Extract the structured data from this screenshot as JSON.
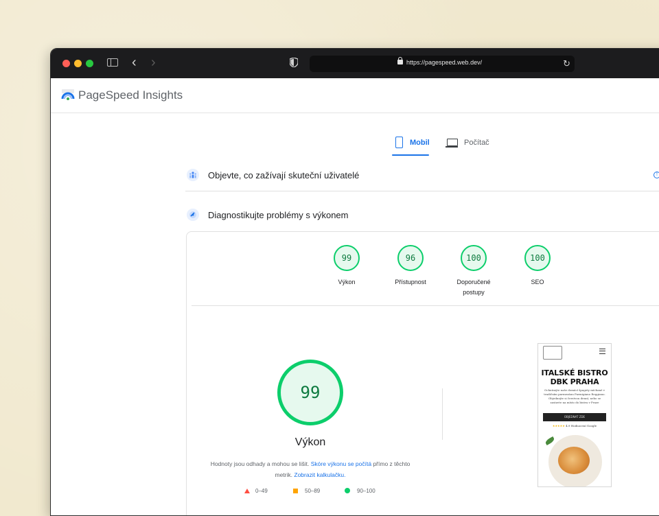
{
  "browser": {
    "url": "https://pagespeed.web.dev/"
  },
  "header": {
    "brand": "PageSpeed Insights"
  },
  "tabs": {
    "mobile": "Mobil",
    "desktop": "Počítač"
  },
  "sections": {
    "users": "Objevte, co zažívají skuteční uživatelé",
    "diagnose": "Diagnostikujte problémy s výkonem"
  },
  "scores": [
    {
      "value": "99",
      "label": "Výkon"
    },
    {
      "value": "96",
      "label": "Přístupnost"
    },
    {
      "value": "100",
      "label": "Doporučené postupy"
    },
    {
      "value": "100",
      "label": "SEO"
    }
  ],
  "performance": {
    "score": "99",
    "label": "Výkon",
    "desc_start": "Hodnoty jsou odhady a mohou se lišit.",
    "desc_link1": "Skóre výkonu se počítá",
    "desc_middle": "přímo z těchto metrik.",
    "desc_link2": "Zobrazit kalkulačku."
  },
  "legend": {
    "fail": "0–49",
    "average": "50–89",
    "pass": "90–100"
  },
  "screenshot": {
    "title_line1": "ITALSKÉ BISTRO",
    "title_line2": "DBK PRAHA",
    "body": "Ochutnejte naše domácí špagety míchané v tradičním parmezánu Parmigiano Reggiano. Objednejte si čerstvou denní, nebo se zastavte na místo do bistra v Praze",
    "button": "OBJEDNAT ZDE",
    "stars": "★★★★★",
    "rating": "4.9 Hodnocení Google"
  },
  "colors": {
    "pass": "#0cce6b",
    "average": "#ffa400",
    "fail": "#ff4e42",
    "link": "#1a73e8"
  }
}
